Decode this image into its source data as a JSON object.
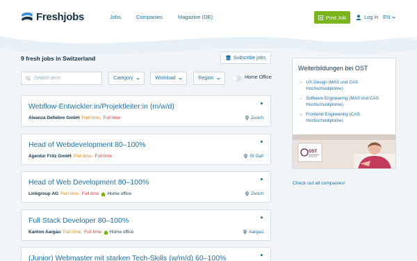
{
  "header": {
    "logo_text": "Freshjobs",
    "nav": [
      "Jobs",
      "Companies",
      "Magazine (DE)"
    ],
    "post_job": "Post Job",
    "login": "Log in",
    "language": "EN"
  },
  "results": {
    "count_text": "9 fresh jobs in Switzerland",
    "subscribe": "Subscribe jobs"
  },
  "filters": {
    "search_placeholder": "Search term",
    "category": "Category",
    "workload": "Workload",
    "region": "Region",
    "home_office": "Home Office",
    "home_office_on": false
  },
  "jobs": [
    {
      "title": "Webflow-Entwickler:in/Projektleiter:in (m/w/d)",
      "company": "Aleanza Defiébre GmbH",
      "part_time": "Part time,",
      "full_time": "Full time",
      "home_office": "",
      "location": "Zurich"
    },
    {
      "title": "Head of Webdevelopment 80–100%",
      "company": "Agentur Fritz GmbH",
      "part_time": "Part time,",
      "full_time": "Full time",
      "home_office": "",
      "location": "St Gall"
    },
    {
      "title": "Head of Web Development 80–100%",
      "company": "Linkgroup AG",
      "part_time": "Part time,",
      "full_time": "Full time",
      "home_office": "Home office",
      "location": "Zurich"
    },
    {
      "title": "Full Stack Developer 80–100%",
      "company": "Kanton Aargau",
      "part_time": "Part time,",
      "full_time": "Full time",
      "home_office": "Home office",
      "location": "Aargau"
    },
    {
      "title": "(Junior) Webmaster mit starken Tech-Skills (w/m/d) 60–100%",
      "company": "",
      "part_time": "",
      "full_time": "",
      "home_office": "",
      "location": ""
    }
  ],
  "sidebar": {
    "title": "Weiterbildungen bei OST",
    "items": [
      "UX-Design (MAS und CAS Hochschuldiplome)",
      "Software Engineering (MAS und CAS Hochschuldiplome)",
      "Frontend Engineering (CAS Hochschuldiplome)"
    ],
    "logo_text": "OST",
    "all_companies": "Check out all companies!"
  },
  "colors": {
    "accent": "#1b6fa8",
    "post_button": "#7ab51d",
    "part_time": "#e08a1e",
    "full_time": "#d63b3b"
  }
}
